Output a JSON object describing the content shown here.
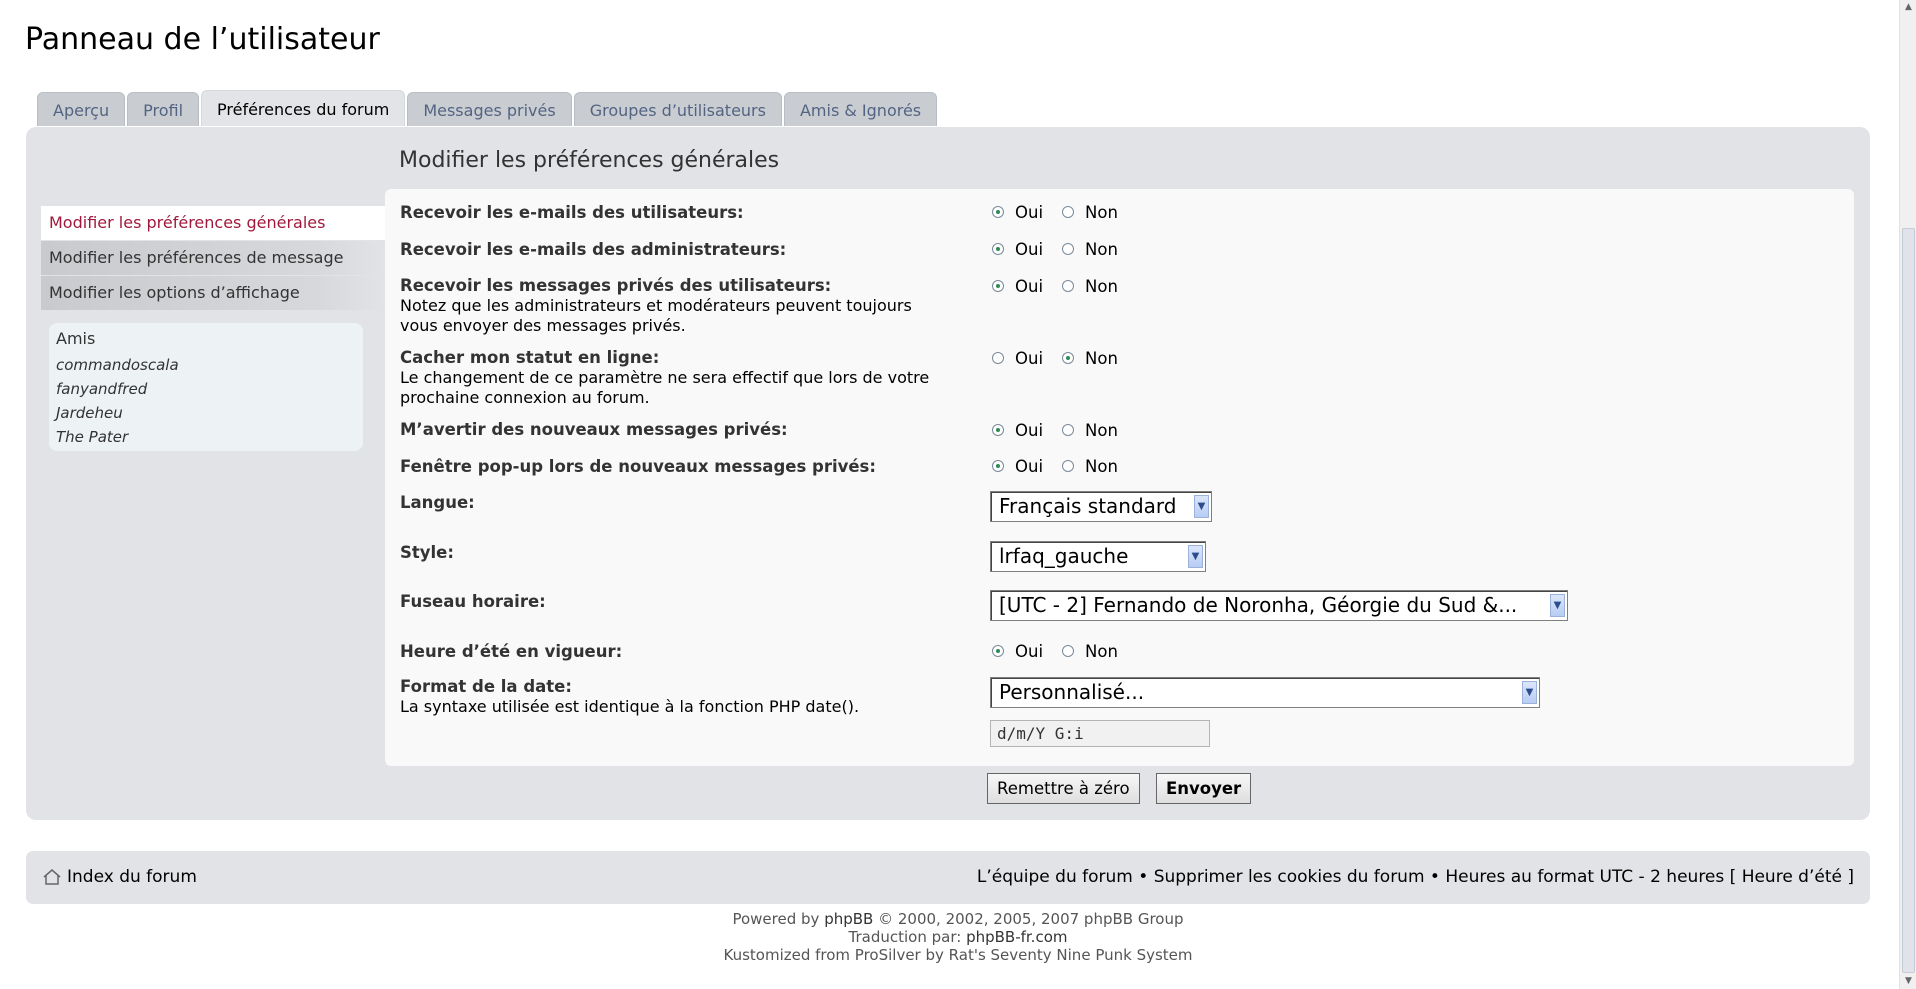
{
  "page_title": "Panneau de l’utilisateur",
  "tabs": [
    {
      "label": "Aperçu"
    },
    {
      "label": "Profil"
    },
    {
      "label": "Préférences du forum",
      "active": true
    },
    {
      "label": "Messages privés"
    },
    {
      "label": "Groupes d’utilisateurs"
    },
    {
      "label": "Amis & Ignorés"
    }
  ],
  "section_title": "Modifier les préférences générales",
  "nav": [
    {
      "label": "Modifier les préférences générales",
      "active": true
    },
    {
      "label": "Modifier les préférences de message"
    },
    {
      "label": "Modifier les options d’affichage"
    }
  ],
  "friends": {
    "title": "Amis",
    "list": [
      "commandoscala",
      "fanyandfred",
      "Jardeheu",
      "The Pater"
    ]
  },
  "form": {
    "radio_yes": "Oui",
    "radio_no": "Non",
    "rows": [
      {
        "label": "Recevoir les e-mails des utilisateurs:",
        "value": "Oui"
      },
      {
        "label": "Recevoir les e-mails des administrateurs:",
        "value": "Oui"
      },
      {
        "label": "Recevoir les messages privés des utilisateurs:",
        "explain_1": "Notez que les administrateurs et modérateurs peuvent toujours",
        "explain_2": "vous envoyer des messages privés.",
        "value": "Oui"
      },
      {
        "label": "Cacher mon statut en ligne:",
        "explain_1": "Le changement de ce paramètre ne sera effectif que lors de votre",
        "explain_2": "prochaine connexion au forum.",
        "value": "Non"
      },
      {
        "label": "M’avertir des nouveaux messages privés:",
        "value": "Oui"
      },
      {
        "label": "Fenêtre pop-up lors de nouveaux messages privés:",
        "value": "Oui"
      }
    ],
    "language": {
      "label": "Langue:",
      "value": "Français standard"
    },
    "style": {
      "label": "Style:",
      "value": "lrfaq_gauche"
    },
    "timezone": {
      "label": "Fuseau horaire:",
      "value": "[UTC - 2] Fernando de Noronha, Géorgie du Sud &..."
    },
    "dst": {
      "label": "Heure d’été en vigueur:",
      "value": "Oui"
    },
    "date_format": {
      "label": "Format de la date:",
      "explain": "La syntaxe utilisée est identique à la fonction PHP date().",
      "select_value": "Personnalisé...",
      "custom_value": "d/m/Y G:i"
    },
    "reset_label": "Remettre à zéro",
    "submit_label": "Envoyer"
  },
  "footer_nav": {
    "home": "Index du forum",
    "team": "L’équipe du forum",
    "separator": " • ",
    "delete_cookies": "Supprimer les cookies du forum",
    "timezone_note": "Heures au format UTC - 2 heures [ Heure d’été ]"
  },
  "copyright": {
    "powered_prefix": "Powered by ",
    "powered_link": "phpBB",
    "powered_suffix": " © 2000, 2002, 2005, 2007 phpBB Group",
    "translation_prefix": "Traduction par: ",
    "translation_link": "phpBB-fr.com",
    "kustomized": "Kustomized from ProSilver by Rat's Seventy Nine Punk System"
  },
  "colors": {
    "active_nav": "#a0193d",
    "tab_text": "#536482",
    "panel_bg": "#e1e3e6",
    "radio_checked": "#2e8b57"
  }
}
